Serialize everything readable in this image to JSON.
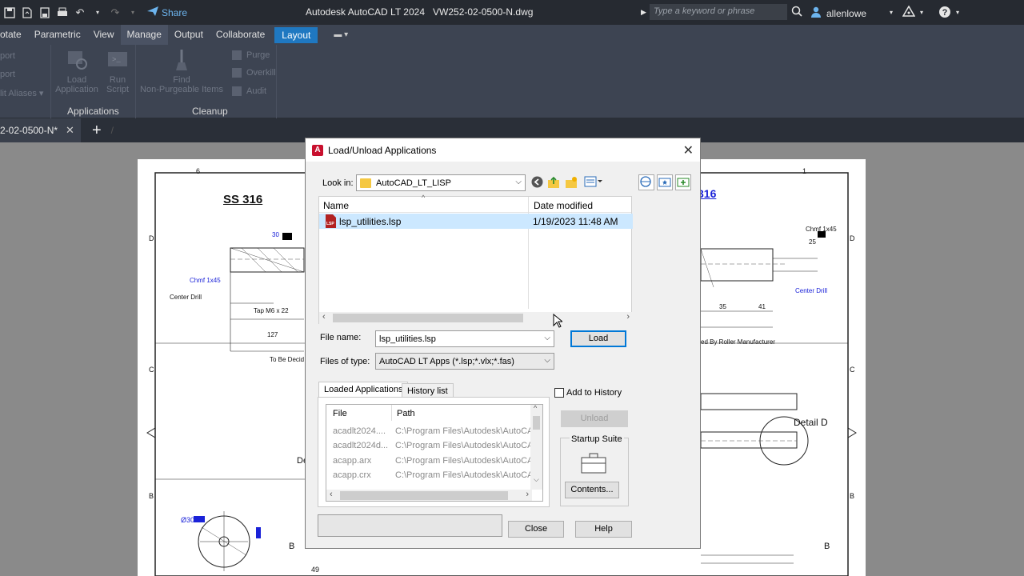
{
  "app": {
    "title": "Autodesk AutoCAD LT 2024",
    "filename": "VW252-02-0500-N.dwg",
    "share_label": "Share",
    "search_placeholder": "Type a keyword or phrase",
    "user_name": "allenlowe"
  },
  "ribbon": {
    "tabs": [
      "otate",
      "Parametric",
      "View",
      "Manage",
      "Output",
      "Collaborate",
      "Layout"
    ],
    "active_tab": "Manage",
    "left_items": [
      "port",
      "port",
      "lit Aliases ▾"
    ],
    "load_application": [
      "Load",
      "Application"
    ],
    "run_script": [
      "Run",
      "Script"
    ],
    "find_nonpurgeable": [
      "Find",
      "Non-Purgeable Items"
    ],
    "cleanup_items": [
      "Purge",
      "Overkill",
      "Audit"
    ],
    "panel_applications": "Applications",
    "panel_cleanup": "Cleanup"
  },
  "doctab": {
    "name": "2-02-0500-N*"
  },
  "drawing": {
    "ss_left": "SS 316",
    "ss_right": "316",
    "detail_label": "Detail D",
    "labels_left": [
      "Chmf 1x45",
      "Center Drill",
      "Tap M6 x 22",
      "127",
      "To Be Decid",
      "Ø30",
      "B",
      "49",
      "De"
    ],
    "labels_right": [
      "Chmf 1x45",
      "25",
      "Center Drill",
      "35",
      "41",
      "ed By Roller Manufacturer",
      "B"
    ],
    "border_letters": [
      "D",
      "C",
      "B",
      "D",
      "C",
      "B"
    ],
    "border_numbers": [
      "6",
      "1"
    ],
    "small_nums": [
      "30"
    ]
  },
  "dialog": {
    "title": "Load/Unload Applications",
    "look_in_label": "Look in:",
    "look_in_value": "AutoCAD_LT_LISP",
    "col_name": "Name",
    "col_date": "Date modified",
    "files": [
      {
        "name": "lsp_utilities.lsp",
        "date": "1/19/2023 11:48 AM"
      }
    ],
    "file_name_label": "File name:",
    "file_name_value": "lsp_utilities.lsp",
    "files_of_type_label": "Files of type:",
    "files_of_type_value": "AutoCAD LT Apps (*.lsp;*.vlx;*.fas)",
    "load_button": "Load",
    "tab_loaded": "Loaded Applications",
    "tab_history": "History list",
    "add_to_history": "Add to History",
    "unload_button": "Unload",
    "startup_suite": "Startup Suite",
    "contents_button": "Contents...",
    "list_col_file": "File",
    "list_col_path": "Path",
    "loaded_apps": [
      {
        "file": "acadlt2024....",
        "path": "C:\\Program Files\\Autodesk\\AutoCA"
      },
      {
        "file": "acadlt2024d...",
        "path": "C:\\Program Files\\Autodesk\\AutoCA"
      },
      {
        "file": "acapp.arx",
        "path": "C:\\Program Files\\Autodesk\\AutoCA"
      },
      {
        "file": "acapp.crx",
        "path": "C:\\Program Files\\Autodesk\\AutoCA"
      }
    ],
    "close_button": "Close",
    "help_button": "Help"
  },
  "colors": {
    "title_bg": "#262a31",
    "ribbon_bg": "#3d4452",
    "layout_tab": "#1f78c1",
    "selection": "#cce8ff",
    "primary_border": "#0078d7"
  }
}
